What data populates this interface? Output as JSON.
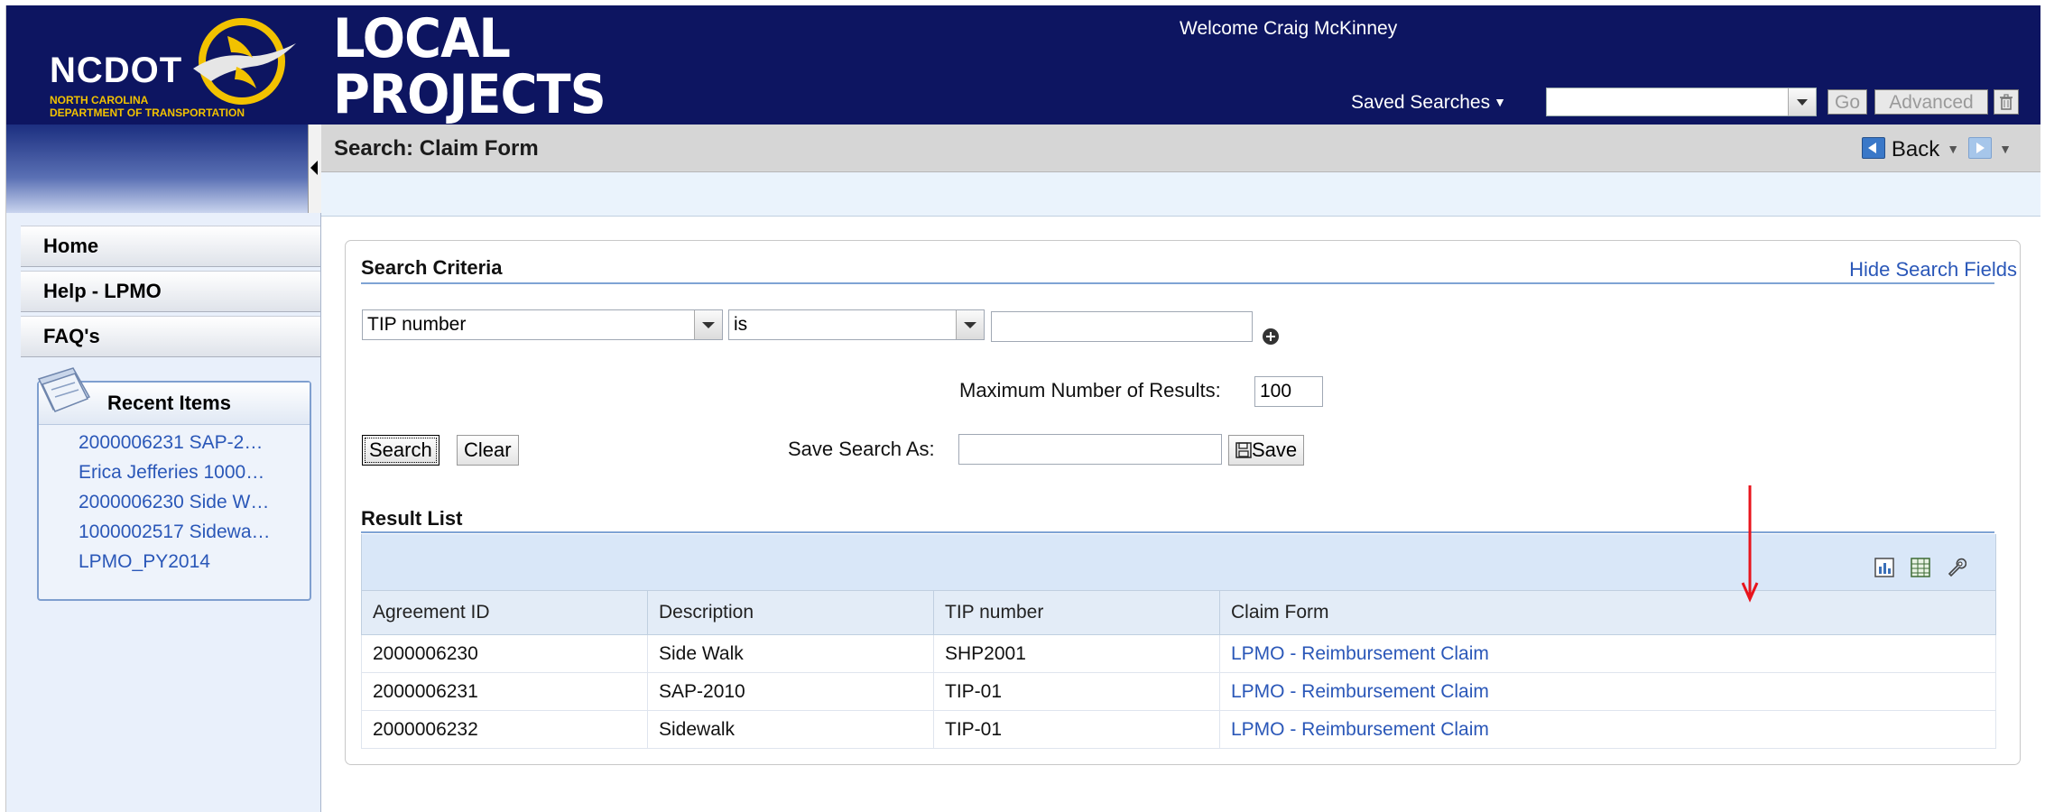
{
  "brand": {
    "name": "NCDOT",
    "sub_line1": "NORTH CAROLINA",
    "sub_line2": "DEPARTMENT OF TRANSPORTATION"
  },
  "app": {
    "title_line1": "LOCAL",
    "title_line2": "PROJECTS"
  },
  "header": {
    "welcome": "Welcome Craig McKinney",
    "saved_searches_label": "Saved Searches",
    "saved_search_value": "",
    "go_label": "Go",
    "advanced_label": "Advanced"
  },
  "sidebar": {
    "nav": [
      "Home",
      "Help - LPMO",
      "FAQ's"
    ],
    "recent_title": "Recent Items",
    "recent_items": [
      "2000006231 SAP-2…",
      "Erica Jefferies 1000…",
      "2000006230 Side W…",
      "1000002517 Sidewa…",
      "LPMO_PY2014"
    ]
  },
  "page": {
    "title": "Search: Claim Form",
    "back_label": "Back"
  },
  "search": {
    "section_title": "Search Criteria",
    "hide_link": "Hide Search Fields",
    "field_select": "TIP number",
    "operator_select": "is",
    "value": "",
    "max_results_label": "Maximum Number of Results:",
    "max_results_value": "100",
    "search_button": "Search",
    "clear_button": "Clear",
    "save_as_label": "Save Search As:",
    "save_as_value": "",
    "save_button": "Save"
  },
  "results": {
    "section_title": "Result List",
    "columns": [
      "Agreement ID",
      "Description",
      "TIP number",
      "Claim Form"
    ],
    "rows": [
      [
        "2000006230",
        "Side Walk",
        "SHP2001",
        "LPMO - Reimbursement Claim"
      ],
      [
        "2000006231",
        "SAP-2010",
        "TIP-01",
        "LPMO - Reimbursement Claim"
      ],
      [
        "2000006232",
        "Sidewalk",
        "TIP-01",
        "LPMO - Reimbursement Claim"
      ]
    ]
  },
  "colors": {
    "header_bg": "#0d1561",
    "brand_yellow": "#f2c200",
    "link_blue": "#2a57b8",
    "annotation_red": "#e8141c"
  },
  "icons": [
    "ncdot-logo-icon",
    "recent-items-icon",
    "back-icon",
    "forward-icon",
    "add-criteria-icon",
    "save-disk-icon",
    "trash-icon",
    "chart-icon",
    "spreadsheet-icon",
    "settings-wrench-icon"
  ]
}
